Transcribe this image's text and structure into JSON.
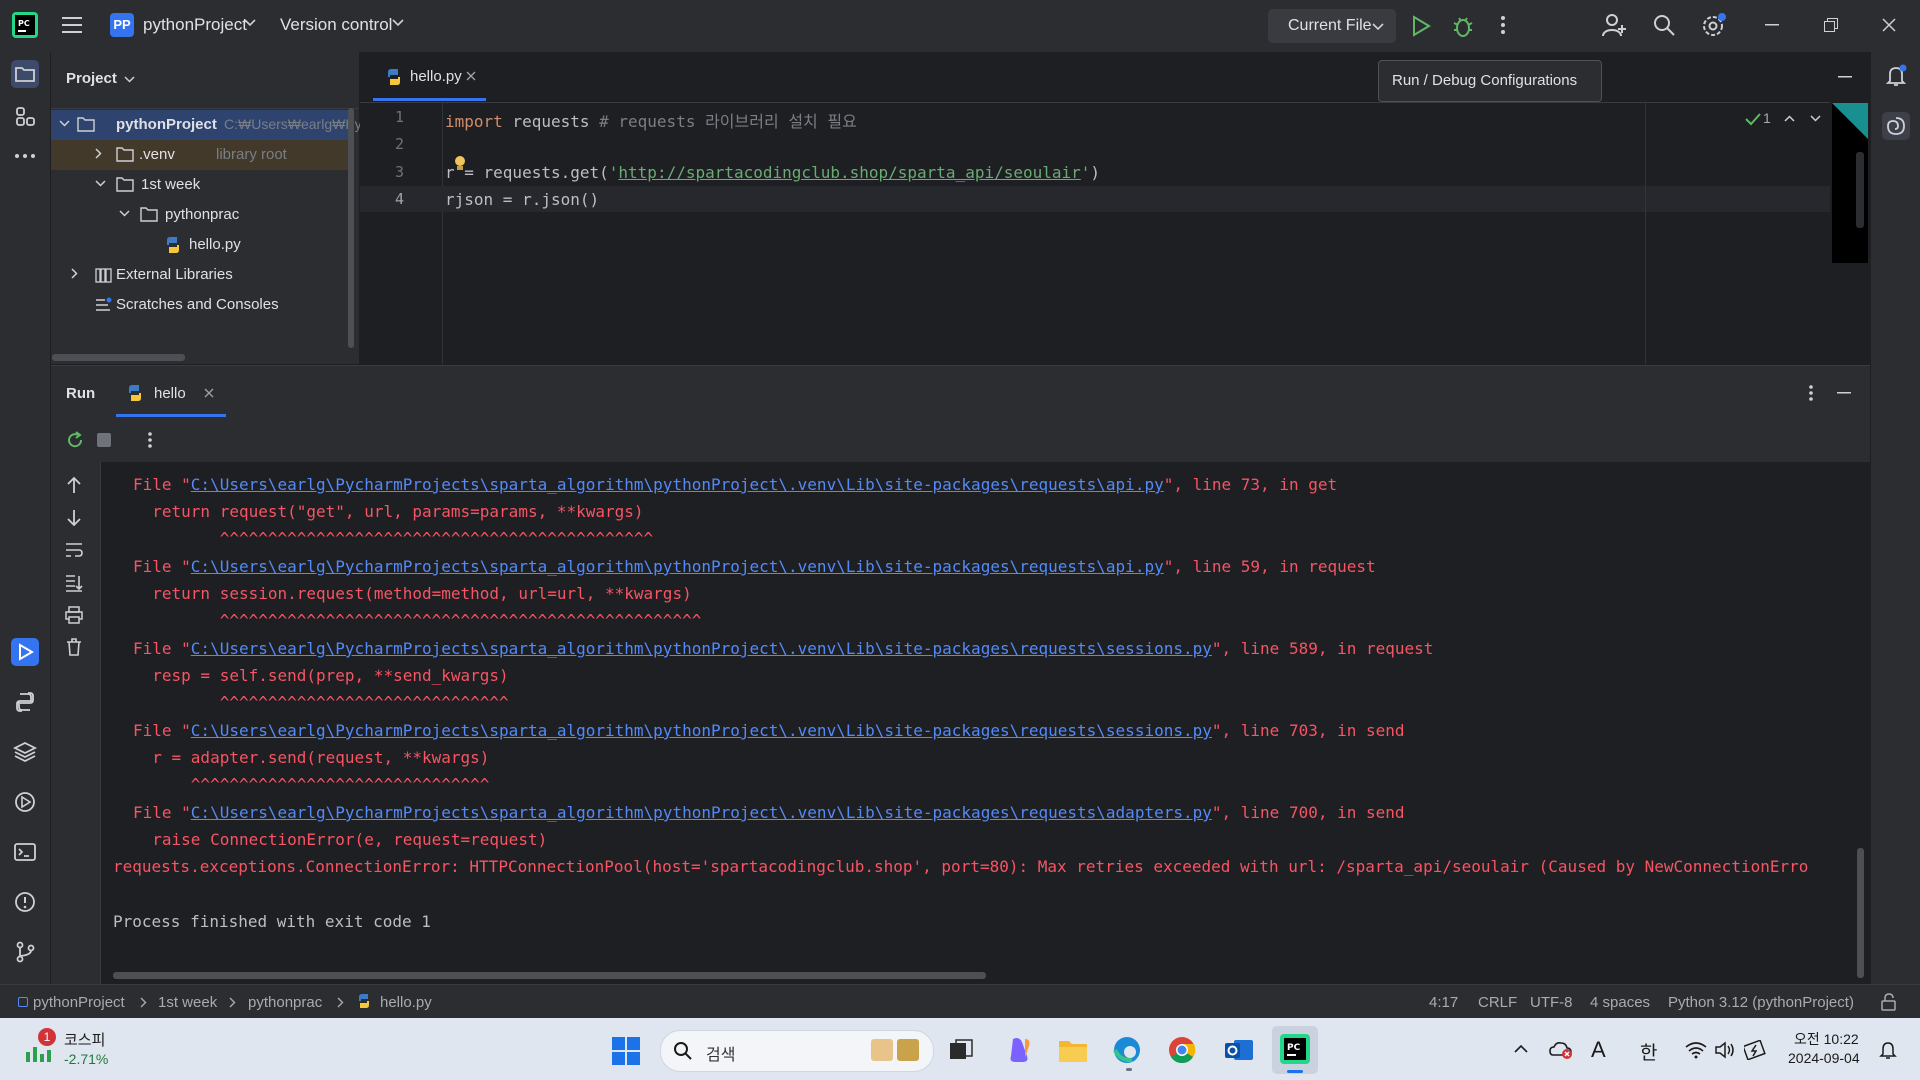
{
  "titlebar": {
    "project_badge": "PP",
    "project_name": "pythonProject",
    "version_control": "Version control",
    "run_config": "Current File"
  },
  "tooltip": "Run / Debug Configurations",
  "project_panel": {
    "title": "Project",
    "tree": [
      {
        "label": "pythonProject",
        "extra": "C:₩Users₩earlg₩Pyc"
      },
      {
        "label": ".venv",
        "extra": "library root"
      },
      {
        "label": "1st week",
        "extra": ""
      },
      {
        "label": "pythonprac",
        "extra": ""
      },
      {
        "label": "hello.py",
        "extra": ""
      },
      {
        "label": "External Libraries",
        "extra": ""
      },
      {
        "label": "Scratches and Consoles",
        "extra": ""
      }
    ]
  },
  "editor": {
    "tab": "hello.py",
    "inspection_count": "1",
    "line_numbers": [
      "1",
      "2",
      "3",
      "4"
    ],
    "lines": {
      "l1_kw": "import",
      "l1_rest": " requests ",
      "l1_comment": "# requests 라이브러리 설치 필요",
      "l3_pre": "r = requests.get(",
      "l3_q1": "'",
      "l3_url": "http://spartacodingclub.shop/sparta_api/seoulair",
      "l3_q2": "'",
      "l3_post": ")",
      "l4": "rjson = r.json()"
    }
  },
  "run_panel": {
    "title": "Run",
    "tab": "hello",
    "console": [
      {
        "pre": "File \"",
        "link": "C:\\Users\\earlg\\PycharmProjects\\sparta_algorithm\\pythonProject\\.venv\\Lib\\site-packages\\requests\\api.py",
        "post": "\", line 73, in get"
      },
      {
        "text": "  return request(\"get\", url, params=params, **kwargs)"
      },
      {
        "text": "         ^^^^^^^^^^^^^^^^^^^^^^^^^^^^^^^^^^^^^^^^^^^^^"
      },
      {
        "pre": "File \"",
        "link": "C:\\Users\\earlg\\PycharmProjects\\sparta_algorithm\\pythonProject\\.venv\\Lib\\site-packages\\requests\\api.py",
        "post": "\", line 59, in request"
      },
      {
        "text": "  return session.request(method=method, url=url, **kwargs)"
      },
      {
        "text": "         ^^^^^^^^^^^^^^^^^^^^^^^^^^^^^^^^^^^^^^^^^^^^^^^^^^"
      },
      {
        "pre": "File \"",
        "link": "C:\\Users\\earlg\\PycharmProjects\\sparta_algorithm\\pythonProject\\.venv\\Lib\\site-packages\\requests\\sessions.py",
        "post": "\", line 589, in request"
      },
      {
        "text": "  resp = self.send(prep, **send_kwargs)"
      },
      {
        "text": "         ^^^^^^^^^^^^^^^^^^^^^^^^^^^^^^"
      },
      {
        "pre": "File \"",
        "link": "C:\\Users\\earlg\\PycharmProjects\\sparta_algorithm\\pythonProject\\.venv\\Lib\\site-packages\\requests\\sessions.py",
        "post": "\", line 703, in send"
      },
      {
        "text": "  r = adapter.send(request, **kwargs)"
      },
      {
        "text": "      ^^^^^^^^^^^^^^^^^^^^^^^^^^^^^^^"
      },
      {
        "pre": "File \"",
        "link": "C:\\Users\\earlg\\PycharmProjects\\sparta_algorithm\\pythonProject\\.venv\\Lib\\site-packages\\requests\\adapters.py",
        "post": "\", line 700, in send"
      },
      {
        "text": "  raise ConnectionError(e, request=request)"
      }
    ],
    "error_line": "requests.exceptions.ConnectionError: HTTPConnectionPool(host='spartacodingclub.shop', port=80): Max retries exceeded with url: /sparta_api/seoulair (Caused by NewConnectionErro",
    "exit_line": "Process finished with exit code 1"
  },
  "statusbar": {
    "breadcrumb": [
      "pythonProject",
      "1st week",
      "pythonprac",
      "hello.py"
    ],
    "position": "4:17",
    "line_sep": "CRLF",
    "encoding": "UTF-8",
    "indent": "4 spaces",
    "interpreter": "Python 3.12 (pythonProject)"
  },
  "taskbar": {
    "stock_name": "코스피",
    "stock_change": "-2.71%",
    "stock_badge": "1",
    "search_placeholder": "검색",
    "ime_a": "A",
    "ime_han": "한",
    "time": "오전 10:22",
    "date": "2024-09-04"
  },
  "colors": {
    "accent": "#3574f0",
    "error": "#f75464",
    "link": "#548af7",
    "string": "#6aab73",
    "keyword": "#cf8e6d"
  }
}
